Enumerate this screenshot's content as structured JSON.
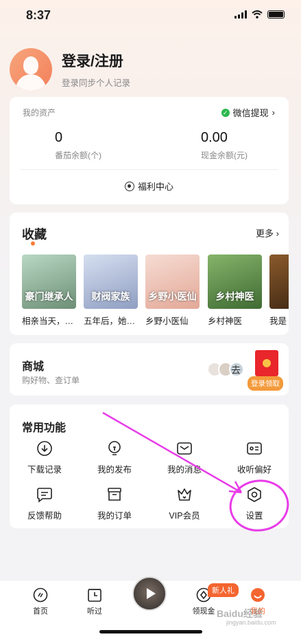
{
  "status": {
    "time": "8:37"
  },
  "profile": {
    "title": "登录/注册",
    "subtitle": "登录同步个人记录"
  },
  "assets": {
    "title": "我的资产",
    "wechat": "微信提现",
    "coins_value": "0",
    "coins_label": "番茄余额(个)",
    "cash_value": "0.00",
    "cash_label": "现金余额(元)",
    "welfare": "福利中心"
  },
  "favorites": {
    "title": "收藏",
    "more": "更多",
    "books": [
      {
        "name": "相亲当天，…",
        "cover_text": "豪门继承人",
        "color1": "#b9d8c4",
        "color2": "#6d8f76"
      },
      {
        "name": "五年后，她…",
        "cover_text": "财阀家族",
        "color1": "#d6dff0",
        "color2": "#8f9ec2"
      },
      {
        "name": "乡野小医仙",
        "cover_text": "乡野小医仙",
        "color1": "#f6dcd3",
        "color2": "#e3a897"
      },
      {
        "name": "乡村神医",
        "cover_text": "乡村神医",
        "color1": "#86b46a",
        "color2": "#3f6b33"
      },
      {
        "name": "我是",
        "cover_text": "",
        "color1": "#8a5a2c",
        "color2": "#3a2410"
      }
    ]
  },
  "mall": {
    "title": "商城",
    "subtitle": "购好物、查订单",
    "go": "去",
    "red_label": "登录领取"
  },
  "functions": {
    "title": "常用功能",
    "items": [
      {
        "label": "下载记录",
        "icon": "download-icon"
      },
      {
        "label": "我的发布",
        "icon": "bulb-icon"
      },
      {
        "label": "我的消息",
        "icon": "mail-icon"
      },
      {
        "label": "收听偏好",
        "icon": "radio-icon"
      },
      {
        "label": "反馈帮助",
        "icon": "chat-icon"
      },
      {
        "label": "我的订单",
        "icon": "box-icon"
      },
      {
        "label": "VIP会员",
        "icon": "crown-icon"
      },
      {
        "label": "设置",
        "icon": "settings-icon"
      }
    ]
  },
  "tabbar": {
    "home": "首页",
    "history": "听过",
    "cash": "领现金",
    "mine": "我的",
    "newbie": "新人礼"
  },
  "watermark": {
    "line1": "Baidu经验",
    "line2": "jingyan.baidu.com"
  },
  "colors": {
    "accent": "#f4652f",
    "annotation": "#e83ce8"
  }
}
